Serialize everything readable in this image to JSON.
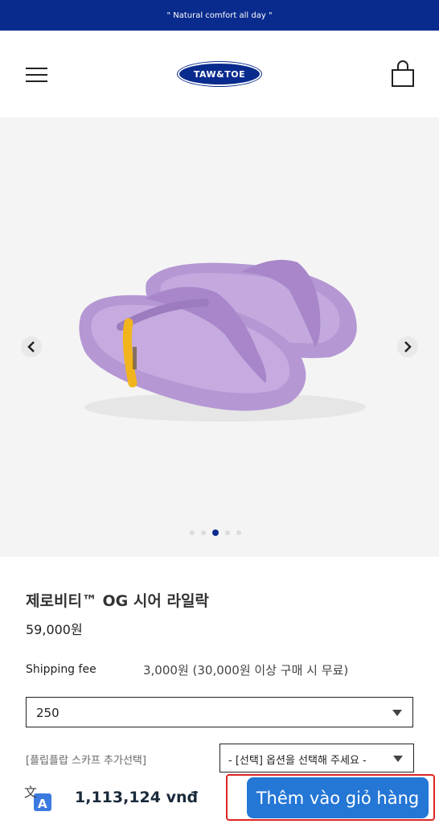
{
  "topbar": {
    "tagline": "\" Natural comfort all day \""
  },
  "header": {
    "logo_text": "TAW&TOE",
    "menu_icon": "hamburger-menu-icon",
    "cart_icon": "shopping-bag-icon"
  },
  "gallery": {
    "current_slide": 3,
    "total_slides": 5
  },
  "product": {
    "name": "제로비티™ OG 시어 라일락",
    "price": "59,000원",
    "shipping_label": "Shipping fee",
    "shipping_value": "3,000원 (30,000원 이상 구매 시 무료)",
    "size_selected": "250",
    "scarf_label": "[플립플랍 스카프 추가선택]",
    "scarf_selected": "- [선택] 옵션을 선택해 주세요 -"
  },
  "bottom_bar": {
    "total": "1,113,124 vnđ",
    "add_to_cart": "Thêm vào giỏ hàng",
    "translate_icon_char": "文",
    "translate_icon_letter": "A"
  },
  "colors": {
    "brand": "#0a2b8e",
    "cta": "#2577d6",
    "highlight": "#e02424",
    "product": "#b79ad6"
  }
}
